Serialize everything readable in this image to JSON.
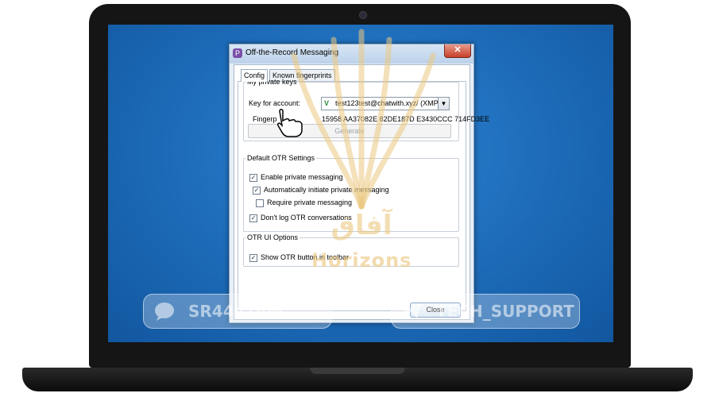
{
  "window": {
    "title": "Off-the-Record Messaging",
    "close_glyph": "✕"
  },
  "tabs": [
    {
      "label": "Config",
      "active": true
    },
    {
      "label": "Known fingerprints",
      "active": false
    }
  ],
  "private_keys": {
    "legend": "My private keys",
    "account_label": "Key for account:",
    "account_value": "test123test@chatwith.xyz/ (XMPP)",
    "fingerprint_label": "Fingerp",
    "fingerprint_value": "15958 AA37082E 82DE187D E3430CCC 714FD3EE",
    "generate_label": "Generate"
  },
  "default_settings": {
    "legend": "Default OTR Settings",
    "options": [
      {
        "label": "Enable private messaging",
        "checked": true
      },
      {
        "label": "Automatically initiate private messaging",
        "checked": true
      },
      {
        "label": "Require private messaging",
        "checked": false
      },
      {
        "label": "Don't log OTR conversations",
        "checked": true
      }
    ]
  },
  "ui_options": {
    "legend": "OTR UI Options",
    "options": [
      {
        "label": "Show OTR button in toolbar",
        "checked": true
      }
    ]
  },
  "buttons": {
    "close_label": "Close"
  },
  "watermark": {
    "brand": "Horizons",
    "left_handle": "SR444TAW",
    "right_handle": "TECH_SUPPORT"
  },
  "colors": {
    "desktop": "#1f6fbd",
    "laptop": "#151515",
    "dialog_frame": "#e6eef7",
    "checkmark_green": "#2c8a3a"
  }
}
